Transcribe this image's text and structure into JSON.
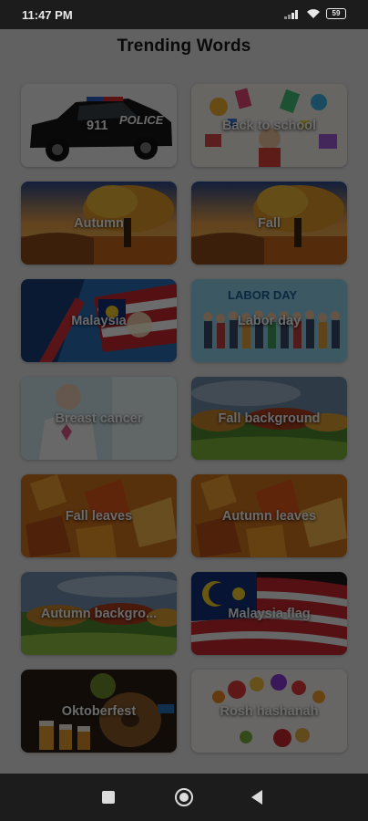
{
  "status": {
    "time": "11:47 PM",
    "battery": "59"
  },
  "page": {
    "title": "Trending Words"
  },
  "tiles": [
    {
      "label": "",
      "art": "police-car"
    },
    {
      "label": "Back to school",
      "art": "school"
    },
    {
      "label": "Autumn",
      "art": "autumn-tree"
    },
    {
      "label": "Fall",
      "art": "autumn-tree"
    },
    {
      "label": "Malaysia",
      "art": "flags"
    },
    {
      "label": "Labor day",
      "art": "labor",
      "art_text": "LABOR DAY"
    },
    {
      "label": "Breast cancer",
      "art": "cancer"
    },
    {
      "label": "Fall background",
      "art": "landscape"
    },
    {
      "label": "Fall leaves",
      "art": "leaves"
    },
    {
      "label": "Autumn leaves",
      "art": "leaves"
    },
    {
      "label": "Autumn backgro...",
      "art": "landscape"
    },
    {
      "label": "Malaysia flag",
      "art": "malaysia-flag"
    },
    {
      "label": "Oktoberfest",
      "art": "beer"
    },
    {
      "label": "Rosh hashanah",
      "art": "fruits"
    }
  ],
  "police_car": {
    "label": "911",
    "text": "POLICE"
  },
  "colors": {
    "app_bg": "#e6e6e6",
    "title": "#1a1a1a",
    "overlay": "rgba(0,0,0,0.58)"
  }
}
